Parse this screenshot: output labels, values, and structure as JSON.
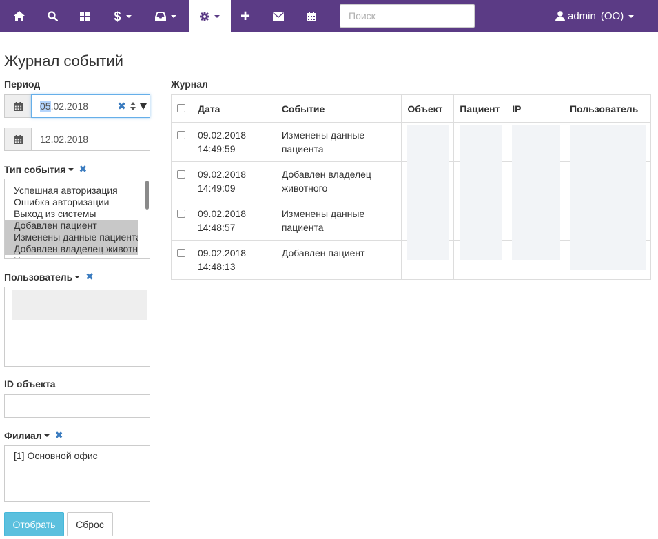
{
  "navbar": {
    "search_placeholder": "Поиск",
    "user": {
      "name": "admin",
      "org": "(OO)"
    },
    "colors": {
      "bg": "#5b3b85",
      "active_bg": "#ffffff"
    },
    "icons": [
      "home-icon",
      "search-icon",
      "grid-icon",
      "dollar-icon",
      "inbox-icon",
      "gear-icon",
      "plus-icon",
      "envelope-icon",
      "calendar-icon"
    ],
    "dollar_symbol": "$",
    "plus_symbol": "+"
  },
  "page": {
    "title": "Журнал событий"
  },
  "filters": {
    "period_label": "Период",
    "date_from": {
      "selected": "05",
      "rest": ".02.2018"
    },
    "date_to": "12.02.2018",
    "event_type_label": "Тип события",
    "clear_symbol": "✖",
    "event_types": [
      {
        "label": "Успешная авторизация",
        "selected": false
      },
      {
        "label": "Ошибка авторизации",
        "selected": false
      },
      {
        "label": "Выход из системы",
        "selected": false
      },
      {
        "label": "Добавлен пациент",
        "selected": true
      },
      {
        "label": "Изменены данные пациента",
        "selected": true
      },
      {
        "label": "Добавлен владелец животного",
        "selected": true
      },
      {
        "label": "Изменены данные владельца",
        "selected": false
      }
    ],
    "user_label": "Пользователь",
    "object_id_label": "ID объекта",
    "object_id_value": "",
    "branch_label": "Филиал",
    "branches": [
      {
        "label": "[1] Основной офис",
        "selected": false
      }
    ]
  },
  "buttons": {
    "submit": "Отобрать",
    "reset": "Сброс"
  },
  "journal": {
    "title": "Журнал",
    "columns": [
      "Дата",
      "Событие",
      "Объект",
      "Пациент",
      "IP",
      "Пользователь"
    ],
    "rows": [
      {
        "date": "09.02.2018",
        "time": "14:49:59",
        "event": "Изменены данные пациента"
      },
      {
        "date": "09.02.2018",
        "time": "14:49:09",
        "event": "Добавлен владелец животного"
      },
      {
        "date": "09.02.2018",
        "time": "14:48:57",
        "event": "Изменены данные пациента"
      },
      {
        "date": "09.02.2018",
        "time": "14:48:13",
        "event": "Добавлен пациент"
      }
    ]
  }
}
